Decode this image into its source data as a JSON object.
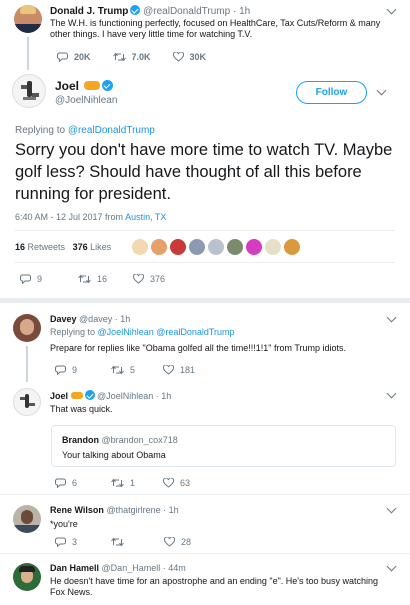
{
  "tweet_trump": {
    "name": "Donald J. Trump",
    "handle": "@realDonaldTrump",
    "time": "1h",
    "text": "The W.H. is functioning perfectly, focused on HealthCare, Tax Cuts/Reform & many other things. I have very little time for watching T.V.",
    "replies": "20K",
    "retweets": "7.0K",
    "likes": "30K"
  },
  "main_tweet": {
    "name": "Joel",
    "handle": "@JoelNihlean",
    "follow_label": "Follow",
    "replying_to_prefix": "Replying to",
    "replying_to": "@realDonaldTrump",
    "text": "Sorry you don't have more time to watch TV. Maybe golf less? Should have thought of all this before running for president.",
    "timestamp": "6:40 AM - 12 Jul 2017 from",
    "location": "Austin, TX",
    "retweets_count": "16",
    "retweets_label": "Retweets",
    "likes_count": "376",
    "likes_label": "Likes",
    "replies": "9",
    "retweets": "16",
    "likes": "376"
  },
  "reply_davey": {
    "name": "Davey",
    "handle": "@davey",
    "time": "1h",
    "replying_to_prefix": "Replying to",
    "replying_to": "@JoelNihlean @realDonaldTrump",
    "text": "Prepare for replies like \"Obama golfed all the time!!!1!1\" from Trump idiots.",
    "replies": "9",
    "retweets": "5",
    "likes": "181"
  },
  "reply_joel": {
    "name": "Joel",
    "handle": "@JoelNihlean",
    "time": "1h",
    "text": "That was quick.",
    "quote_name": "Brandon",
    "quote_handle": "@brandon_cox718",
    "quote_text": "Your talking about Obama",
    "replies": "6",
    "retweets": "1",
    "likes": "63"
  },
  "reply_rene": {
    "name": "Rene Wilson",
    "handle": "@thatgirlrene",
    "time": "1h",
    "text": "*you're",
    "replies": "3",
    "retweets": "",
    "likes": "28"
  },
  "reply_dan": {
    "name": "Dan Hamell",
    "handle": "@Dan_Hamell",
    "time": "44m",
    "text": "He doesn't have time for an apostrophe and an ending \"e\". He's too busy watching Fox News."
  },
  "colors": {
    "link": "#1b95e0",
    "muted": "#657786",
    "verified": "#1da1f2",
    "divider": "#e6ecf0"
  }
}
